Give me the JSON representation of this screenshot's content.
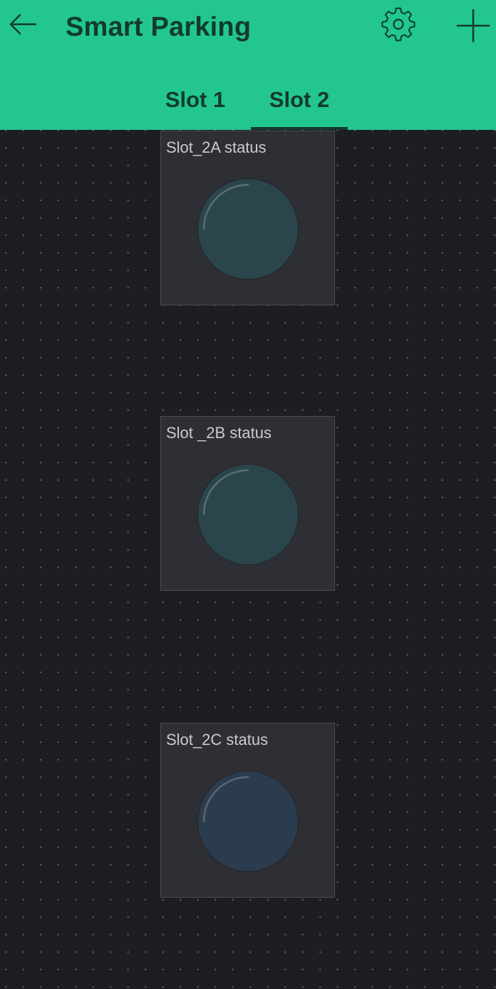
{
  "app_bar": {
    "title": "Smart Parking",
    "back_icon": "arrow-left-icon",
    "settings_icon": "gear-icon",
    "add_icon": "plus-icon",
    "background_color": "#23c68f",
    "foreground_color": "#123b2c"
  },
  "tabs": [
    {
      "label": "Slot 1",
      "selected": false
    },
    {
      "label": "Slot 2",
      "selected": true
    }
  ],
  "widgets": [
    {
      "label": "Slot_2A status",
      "type": "led",
      "state": "off",
      "led_color": "#2b454c"
    },
    {
      "label": "Slot _2B status",
      "type": "led",
      "state": "off",
      "led_color": "#2b454c"
    },
    {
      "label": "Slot_2C status",
      "type": "led",
      "state": "off",
      "led_color": "#2b3c4e"
    }
  ]
}
